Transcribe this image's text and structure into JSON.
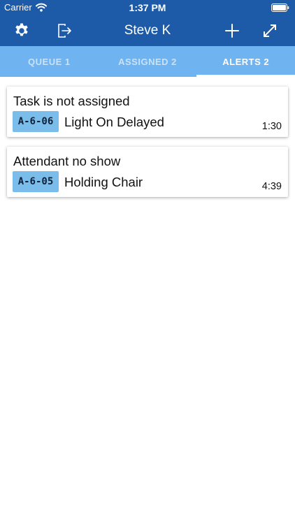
{
  "status_bar": {
    "carrier": "Carrier",
    "time": "1:37 PM"
  },
  "header": {
    "title": "Steve K",
    "icons": [
      "gear-icon",
      "logout-icon",
      "plus-icon",
      "expand-icon"
    ]
  },
  "tabs": [
    {
      "label": "QUEUE 1",
      "active": false
    },
    {
      "label": "ASSIGNED 2",
      "active": false
    },
    {
      "label": "ALERTS 2",
      "active": true
    }
  ],
  "alerts": [
    {
      "title": "Task is not assigned",
      "tag": "A-6-06",
      "description": "Light On Delayed",
      "time": "1:30"
    },
    {
      "title": "Attendant no show",
      "tag": "A-6-05",
      "description": "Holding Chair",
      "time": "4:39"
    }
  ],
  "colors": {
    "header": "#1d5aa8",
    "tabs": "#6fb3f0",
    "tag": "#7abcea"
  }
}
